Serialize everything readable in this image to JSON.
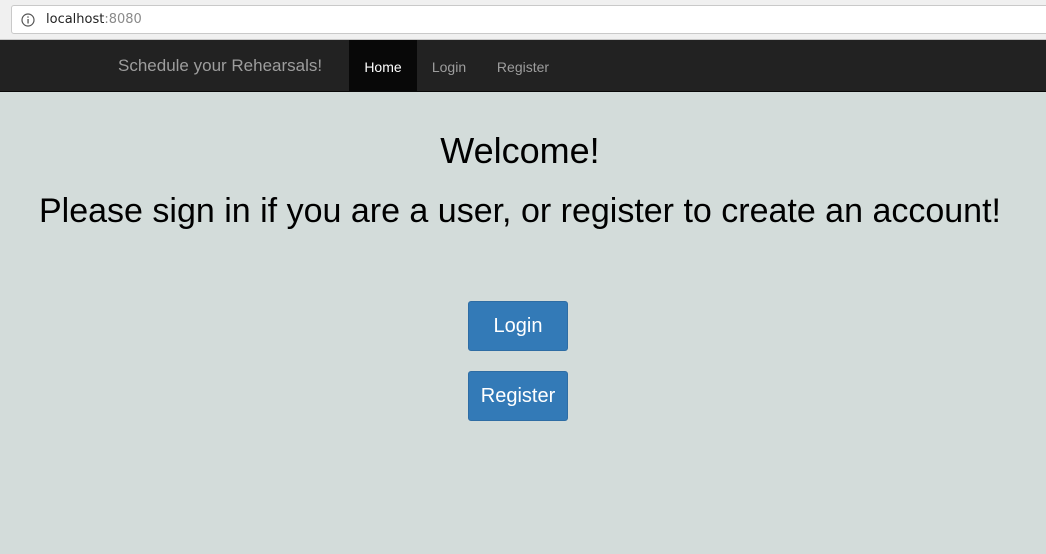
{
  "browser": {
    "url_host": "localhost",
    "url_port": ":8080",
    "info_icon": "info-circle-icon"
  },
  "navbar": {
    "brand": "Schedule your Rehearsals!",
    "items": [
      {
        "label": "Home",
        "active": true
      },
      {
        "label": "Login",
        "active": false
      },
      {
        "label": "Register",
        "active": false
      }
    ]
  },
  "main": {
    "heading": "Welcome!",
    "subheading": "Please sign in if you are a user, or register to create an account!",
    "login_button": "Login",
    "register_button": "Register"
  },
  "colors": {
    "background": "#d3dcda",
    "navbar": "#222222",
    "active_nav": "#080808",
    "primary_button": "#337ab7"
  }
}
